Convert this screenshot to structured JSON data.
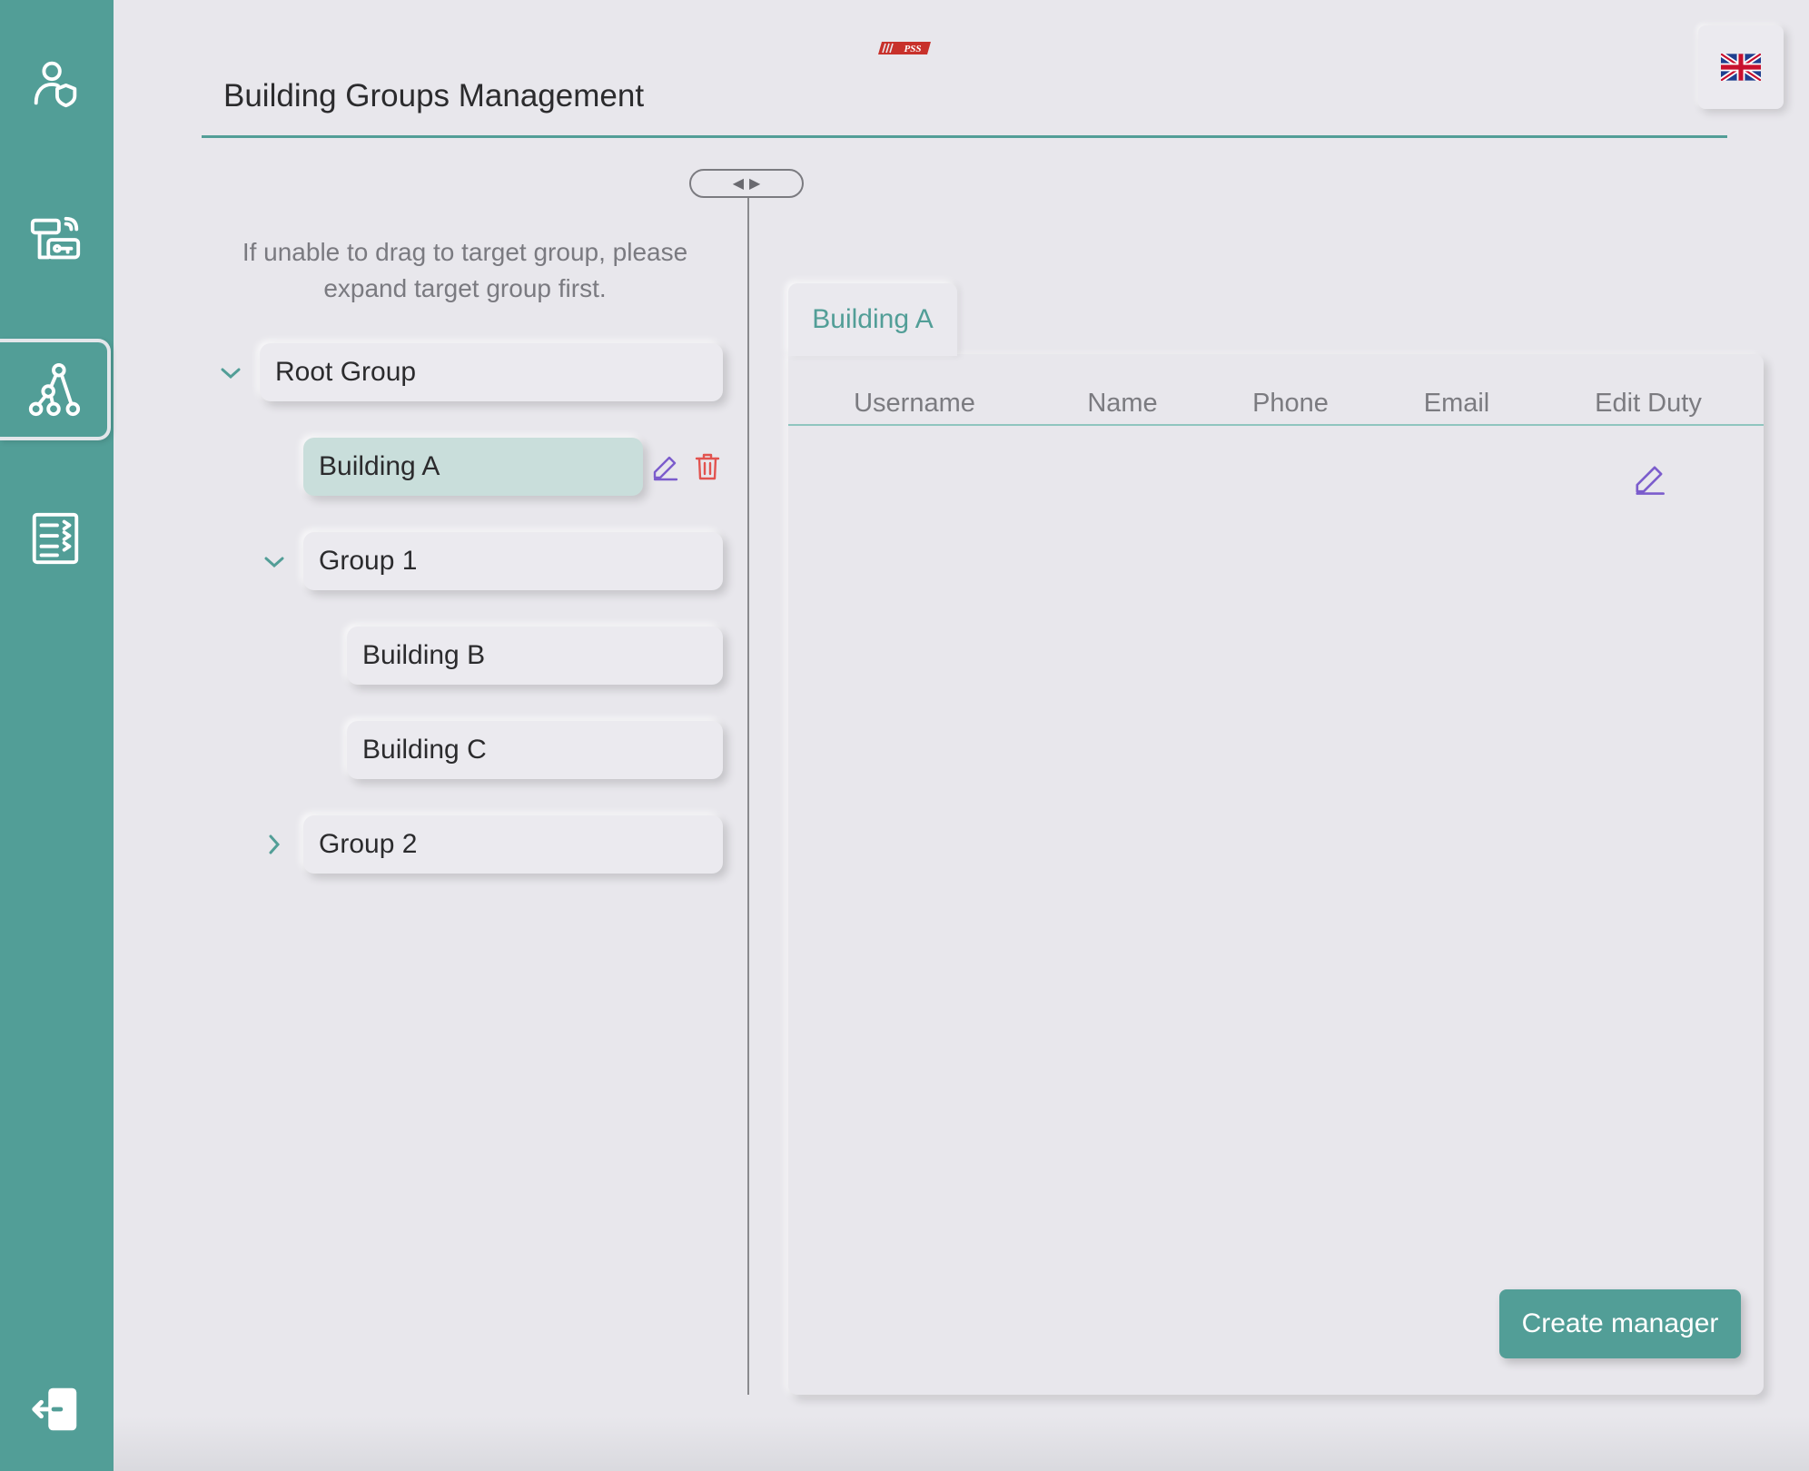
{
  "brand": {
    "logo_text": "PSS",
    "accent_color": "#529e97",
    "logo_color": "#c8312b"
  },
  "sidebar": {
    "items": [
      {
        "id": "users",
        "icon": "user-shield-icon",
        "active": false
      },
      {
        "id": "access",
        "icon": "access-control-icon",
        "active": false
      },
      {
        "id": "groups",
        "icon": "hierarchy-icon",
        "active": true
      },
      {
        "id": "logs",
        "icon": "log-list-icon",
        "active": false
      }
    ],
    "logout_icon": "logout-icon"
  },
  "header": {
    "title": "Building Groups Management",
    "language": {
      "icon": "uk-flag-icon",
      "code": "EN"
    }
  },
  "splitter": {
    "left_glyph": "◀",
    "right_glyph": "▶"
  },
  "tree": {
    "hint": "If unable to drag to target group, please expand target group first.",
    "nodes": [
      {
        "label": "Root Group",
        "expanded": true,
        "level": 0
      },
      {
        "label": "Building A",
        "selected": true,
        "level": 1
      },
      {
        "label": "Group 1",
        "expanded": true,
        "level": 1
      },
      {
        "label": "Building B",
        "level": 2
      },
      {
        "label": "Building C",
        "level": 2
      },
      {
        "label": "Group 2",
        "expanded": false,
        "level": 1
      }
    ],
    "selected_actions": [
      "edit-icon",
      "delete-icon"
    ]
  },
  "detail": {
    "tab_label": "Building A",
    "columns": [
      "Username",
      "Name",
      "Phone",
      "Email",
      "Edit Duty"
    ],
    "rows": [],
    "create_button_label": "Create manager"
  }
}
